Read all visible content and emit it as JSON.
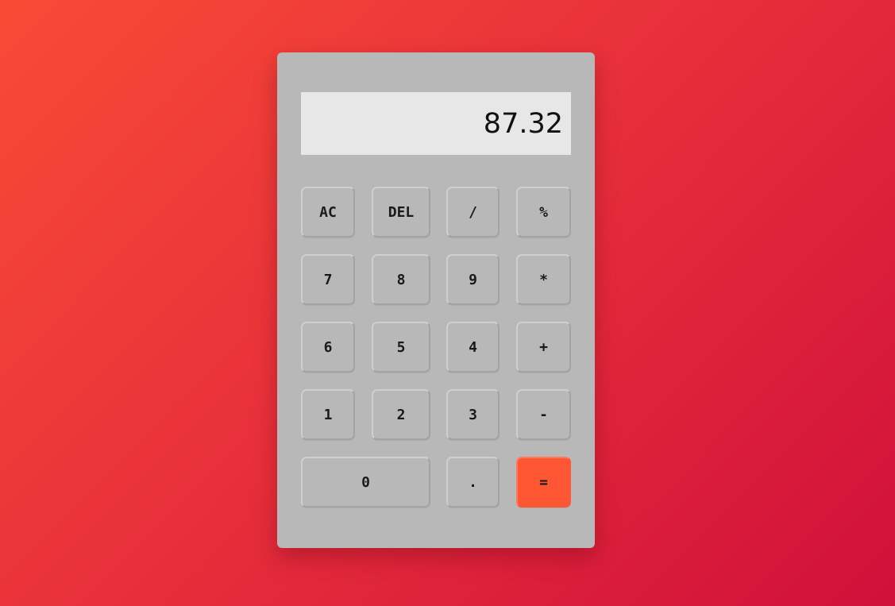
{
  "display": {
    "value": "87.32"
  },
  "keys": {
    "ac": "AC",
    "del": "DEL",
    "divide": "/",
    "percent": "%",
    "seven": "7",
    "eight": "8",
    "nine": "9",
    "multiply": "*",
    "six": "6",
    "five": "5",
    "four": "4",
    "plus": "+",
    "one": "1",
    "two": "2",
    "three": "3",
    "minus": "-",
    "zero": "0",
    "decimal": ".",
    "equals": "="
  },
  "colors": {
    "background_start": "#f84b35",
    "background_end": "#d1103a",
    "body": "#b8b8b8",
    "display": "#e7e7e7",
    "equals": "#ff5733"
  }
}
